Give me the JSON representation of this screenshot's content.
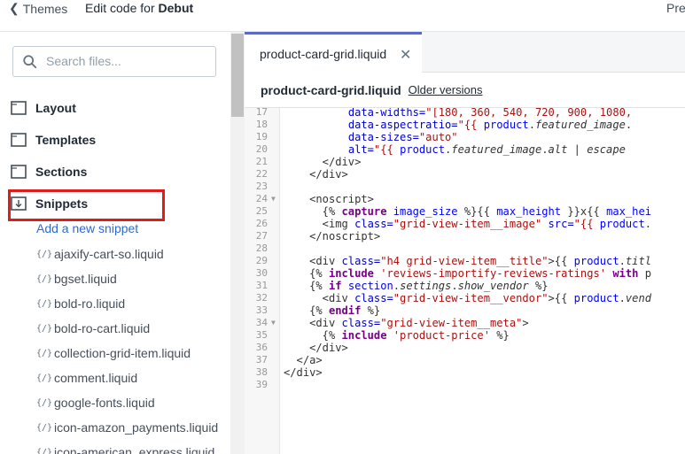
{
  "header": {
    "back_label": "Themes",
    "title_prefix": "Edit code for ",
    "theme_name": "Debut",
    "preview_label": "Preview"
  },
  "sidebar": {
    "search_placeholder": "Search files...",
    "folders": [
      "Layout",
      "Templates",
      "Sections",
      "Snippets"
    ],
    "add_snippet": "Add a new snippet",
    "files": [
      "ajaxify-cart-so.liquid",
      "bgset.liquid",
      "bold-ro.liquid",
      "bold-ro-cart.liquid",
      "collection-grid-item.liquid",
      "comment.liquid",
      "google-fonts.liquid",
      "icon-amazon_payments.liquid",
      "icon-american_express.liquid"
    ],
    "file_icon_glyph": "{/}"
  },
  "editor": {
    "tab_label": "product-card-grid.liquid",
    "file_name": "product-card-grid.liquid",
    "older_versions": "Older versions",
    "line_numbers": [
      "17",
      "18",
      "19",
      "20",
      "21",
      "22",
      "23",
      "24",
      "25",
      "26",
      "27",
      "28",
      "29",
      "30",
      "31",
      "32",
      "33",
      "34",
      "35",
      "36",
      "37",
      "38",
      "39"
    ]
  },
  "colors": {
    "highlight": "#e11a1a",
    "link": "#2f6ad0",
    "tab_accent": "#5c6ac4"
  }
}
